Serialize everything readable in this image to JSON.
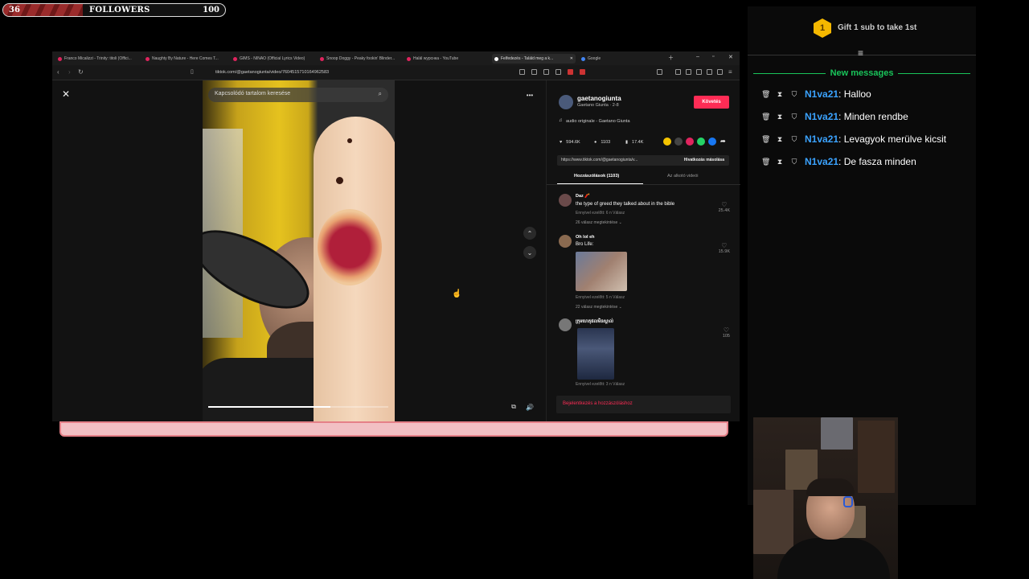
{
  "followers_bar": {
    "current": "36",
    "label": "FOLLOWERS",
    "goal": "100",
    "progress_fraction": 0.36
  },
  "browser": {
    "tabs": [
      {
        "label": "Franco Micalizzi - Trinity: titoli (Offici..."
      },
      {
        "label": "Naughty By Nature - Here Comes T..."
      },
      {
        "label": "GIMS - NINAO (Official Lyrics Video)"
      },
      {
        "label": "Snoop Doggy - Peaky fookin' Blinder..."
      },
      {
        "label": "Halál wypснка - YouTube"
      },
      {
        "label": "Felfedezés - Találd meg a k...",
        "active": true
      },
      {
        "label": "Google"
      }
    ],
    "url": "tiktok.com/@gaetanogiunta/video/7604515710164962583"
  },
  "video": {
    "search_placeholder": "Kapcsolódó tartalom keresése",
    "progress_fraction": 0.68
  },
  "creator": {
    "username": "gaetanogiunta",
    "display": "Gaetano Giunta · 2-8",
    "follow_label": "Követés",
    "audio": "audio originale - Gaetano Giunta"
  },
  "stats": {
    "likes": "594.6K",
    "comments": "1103",
    "saves": "17.4K"
  },
  "link": {
    "url": "https://www.tiktok.com/@gaetanogiunta/v...",
    "copy_label": "Hivatkozás másolása"
  },
  "comment_tabs": {
    "comments": "Hozzászólások (1103)",
    "creator_videos": "Az alkotó videói"
  },
  "comments": [
    {
      "user": "Daz 🧨",
      "text": "the type of greed they talked about in the bible",
      "meta": "Ennyivel ezelőtt: 6 n     Válasz",
      "more": "26 válasz megtekintése ⌄",
      "likes": "25.4K"
    },
    {
      "user": "Oh lol eh",
      "text": "Bro Life:",
      "meta": "Ennyivel ezelőtt: 5 n     Válasz",
      "more": "22 válasz megtekintése ⌄",
      "likes": "15.9K"
    },
    {
      "user": "ក្រុមហេតុផលមិនស្គាល់",
      "text": "",
      "meta": "Ennyivel ezelőtt: 3 n     Válasz",
      "more": "",
      "likes": "105"
    }
  ],
  "login_prompt": "Bejelentkezés a hozzászóláshoz",
  "right_panel": {
    "gift_number": "1",
    "gift_label": "Gift 1 sub to take 1st",
    "new_messages_label": "New messages",
    "messages": [
      {
        "user": "N1va21",
        "text": ": Halloo"
      },
      {
        "user": "N1va21",
        "text": ": Minden rendbe"
      },
      {
        "user": "N1va21",
        "text": ": Levagyok merülve kicsit"
      },
      {
        "user": "N1va21",
        "text": ": De fasza minden"
      }
    ]
  },
  "colors": {
    "accent": "#fe2c55",
    "chat_name": "#3ba3ff",
    "new_messages": "#19c45a",
    "gift_badge": "#f5b800"
  }
}
